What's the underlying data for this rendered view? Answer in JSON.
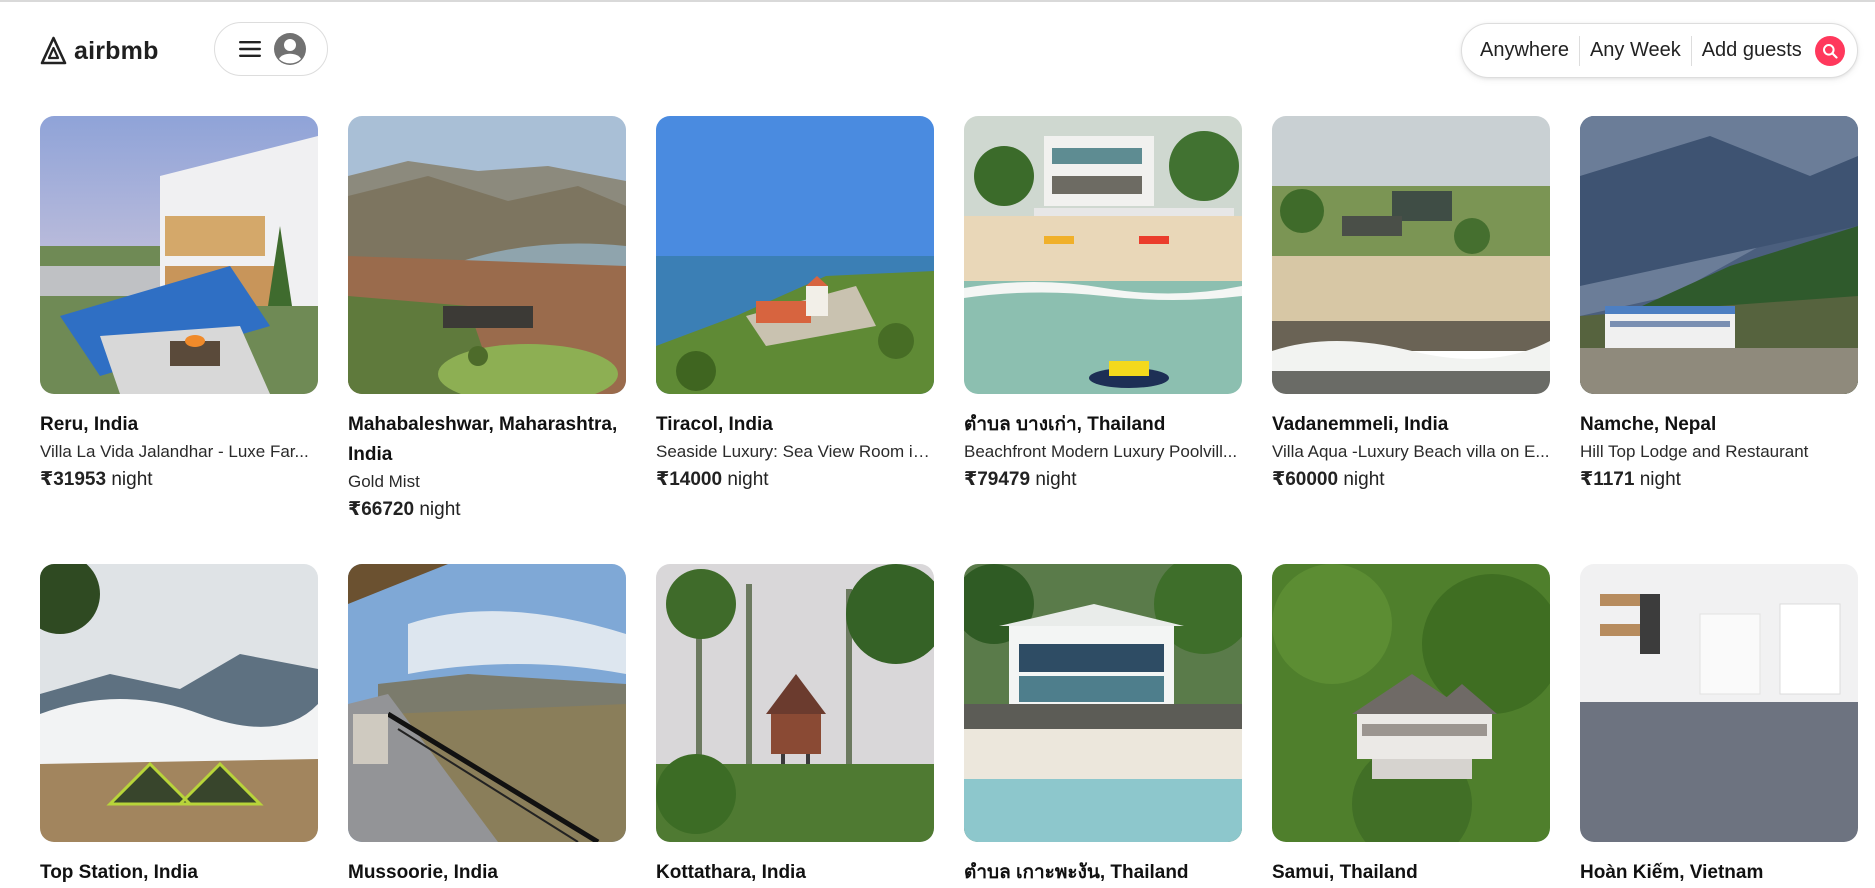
{
  "brand": {
    "name": "airbmb",
    "accent_color": "#ff385c"
  },
  "header": {
    "menu_icon": "hamburger-icon",
    "profile_icon": "user-avatar-icon",
    "search": {
      "location": "Anywhere",
      "dates": "Any Week",
      "guests": "Add guests",
      "search_icon": "magnifier-icon"
    }
  },
  "listings": [
    {
      "location": "Reru, India",
      "name": "Villa La Vida Jalandhar - Luxe Far...",
      "price": "₹31953",
      "unit": "night"
    },
    {
      "location": "Mahabaleshwar, Maharashtra, India",
      "name": "Gold Mist",
      "price": "₹66720",
      "unit": "night"
    },
    {
      "location": "Tiracol, India",
      "name": "Seaside Luxury: Sea View Room in...",
      "price": "₹14000",
      "unit": "night"
    },
    {
      "location": "ตำบล บางเก่า, Thailand",
      "name": "Beachfront Modern Luxury Poolvill...",
      "price": "₹79479",
      "unit": "night"
    },
    {
      "location": "Vadanemmeli, India",
      "name": "Villa Aqua -Luxury Beach villa on E...",
      "price": "₹60000",
      "unit": "night"
    },
    {
      "location": "Namche, Nepal",
      "name": "Hill Top Lodge and Restaurant",
      "price": "₹1171",
      "unit": "night"
    },
    {
      "location": "Top Station, India"
    },
    {
      "location": "Mussoorie, India"
    },
    {
      "location": "Kottathara, India"
    },
    {
      "location": "ตำบล เกาะพะงัน, Thailand"
    },
    {
      "location": "Samui, Thailand"
    },
    {
      "location": "Hoàn Kiếm, Vietnam"
    }
  ]
}
